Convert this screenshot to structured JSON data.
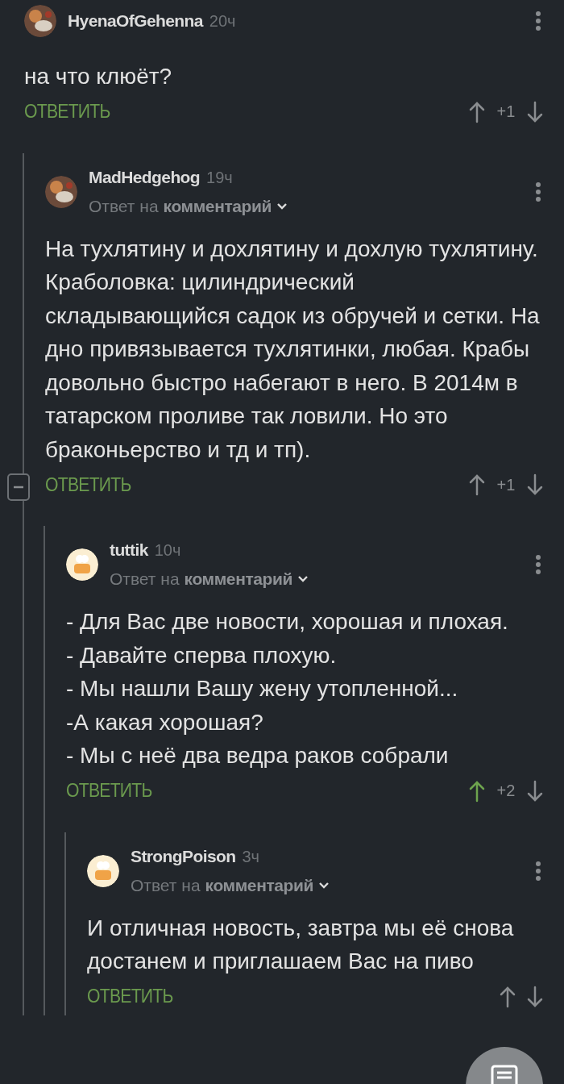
{
  "comments": [
    {
      "author": "HyenaOfGehenna",
      "time": "20ч",
      "avatar": {
        "kind": "photo"
      },
      "body": [
        "на что клюёт?"
      ],
      "reply_label": "ОТВЕТИТЬ",
      "score": "+1",
      "upvoted": false,
      "children": [
        {
          "author": "MadHedgehog",
          "time": "19ч",
          "avatar": {
            "kind": "photo"
          },
          "reply_to": {
            "prefix": "Ответ на",
            "target": "комментарий"
          },
          "body": [
            "На тухлятину и дохлятину и дохлую тухлятину. Краболовка: цилиндрический складывающийся садок из обручей и сетки. На дно привязывается тухлятинки, любая. Крабы довольно быстро набегают в него. В 2014м в татарском проливе так ловили. Но это браконьерство и тд и тп)."
          ],
          "reply_label": "ОТВЕТИТЬ",
          "score": "+1",
          "upvoted": false,
          "thread": {
            "expanded": true
          },
          "children": [
            {
              "author": "tuttik",
              "time": "10ч",
              "avatar": {
                "kind": "cartoon"
              },
              "reply_to": {
                "prefix": "Ответ на",
                "target": "комментарий"
              },
              "body": [
                "- Для Вас две новости, хорошая и плохая.",
                "- Давайте сперва плохую.",
                "- Мы нашли Вашу жену утопленной...",
                "-А какая хорошая?",
                "- Мы с неё два ведра раков собрали"
              ],
              "reply_label": "ОТВЕТИТЬ",
              "score": "+2",
              "upvoted": true,
              "children": [
                {
                  "author": "StrongPoison",
                  "time": "3ч",
                  "avatar": {
                    "kind": "cartoon"
                  },
                  "reply_to": {
                    "prefix": "Ответ на",
                    "target": "комментарий"
                  },
                  "body": [
                    "И отличная новость, завтра мы её снова достанем и приглашаем Вас на пиво"
                  ],
                  "reply_label": "ОТВЕТИТЬ",
                  "upvoted": false
                }
              ]
            }
          ]
        }
      ]
    }
  ]
}
